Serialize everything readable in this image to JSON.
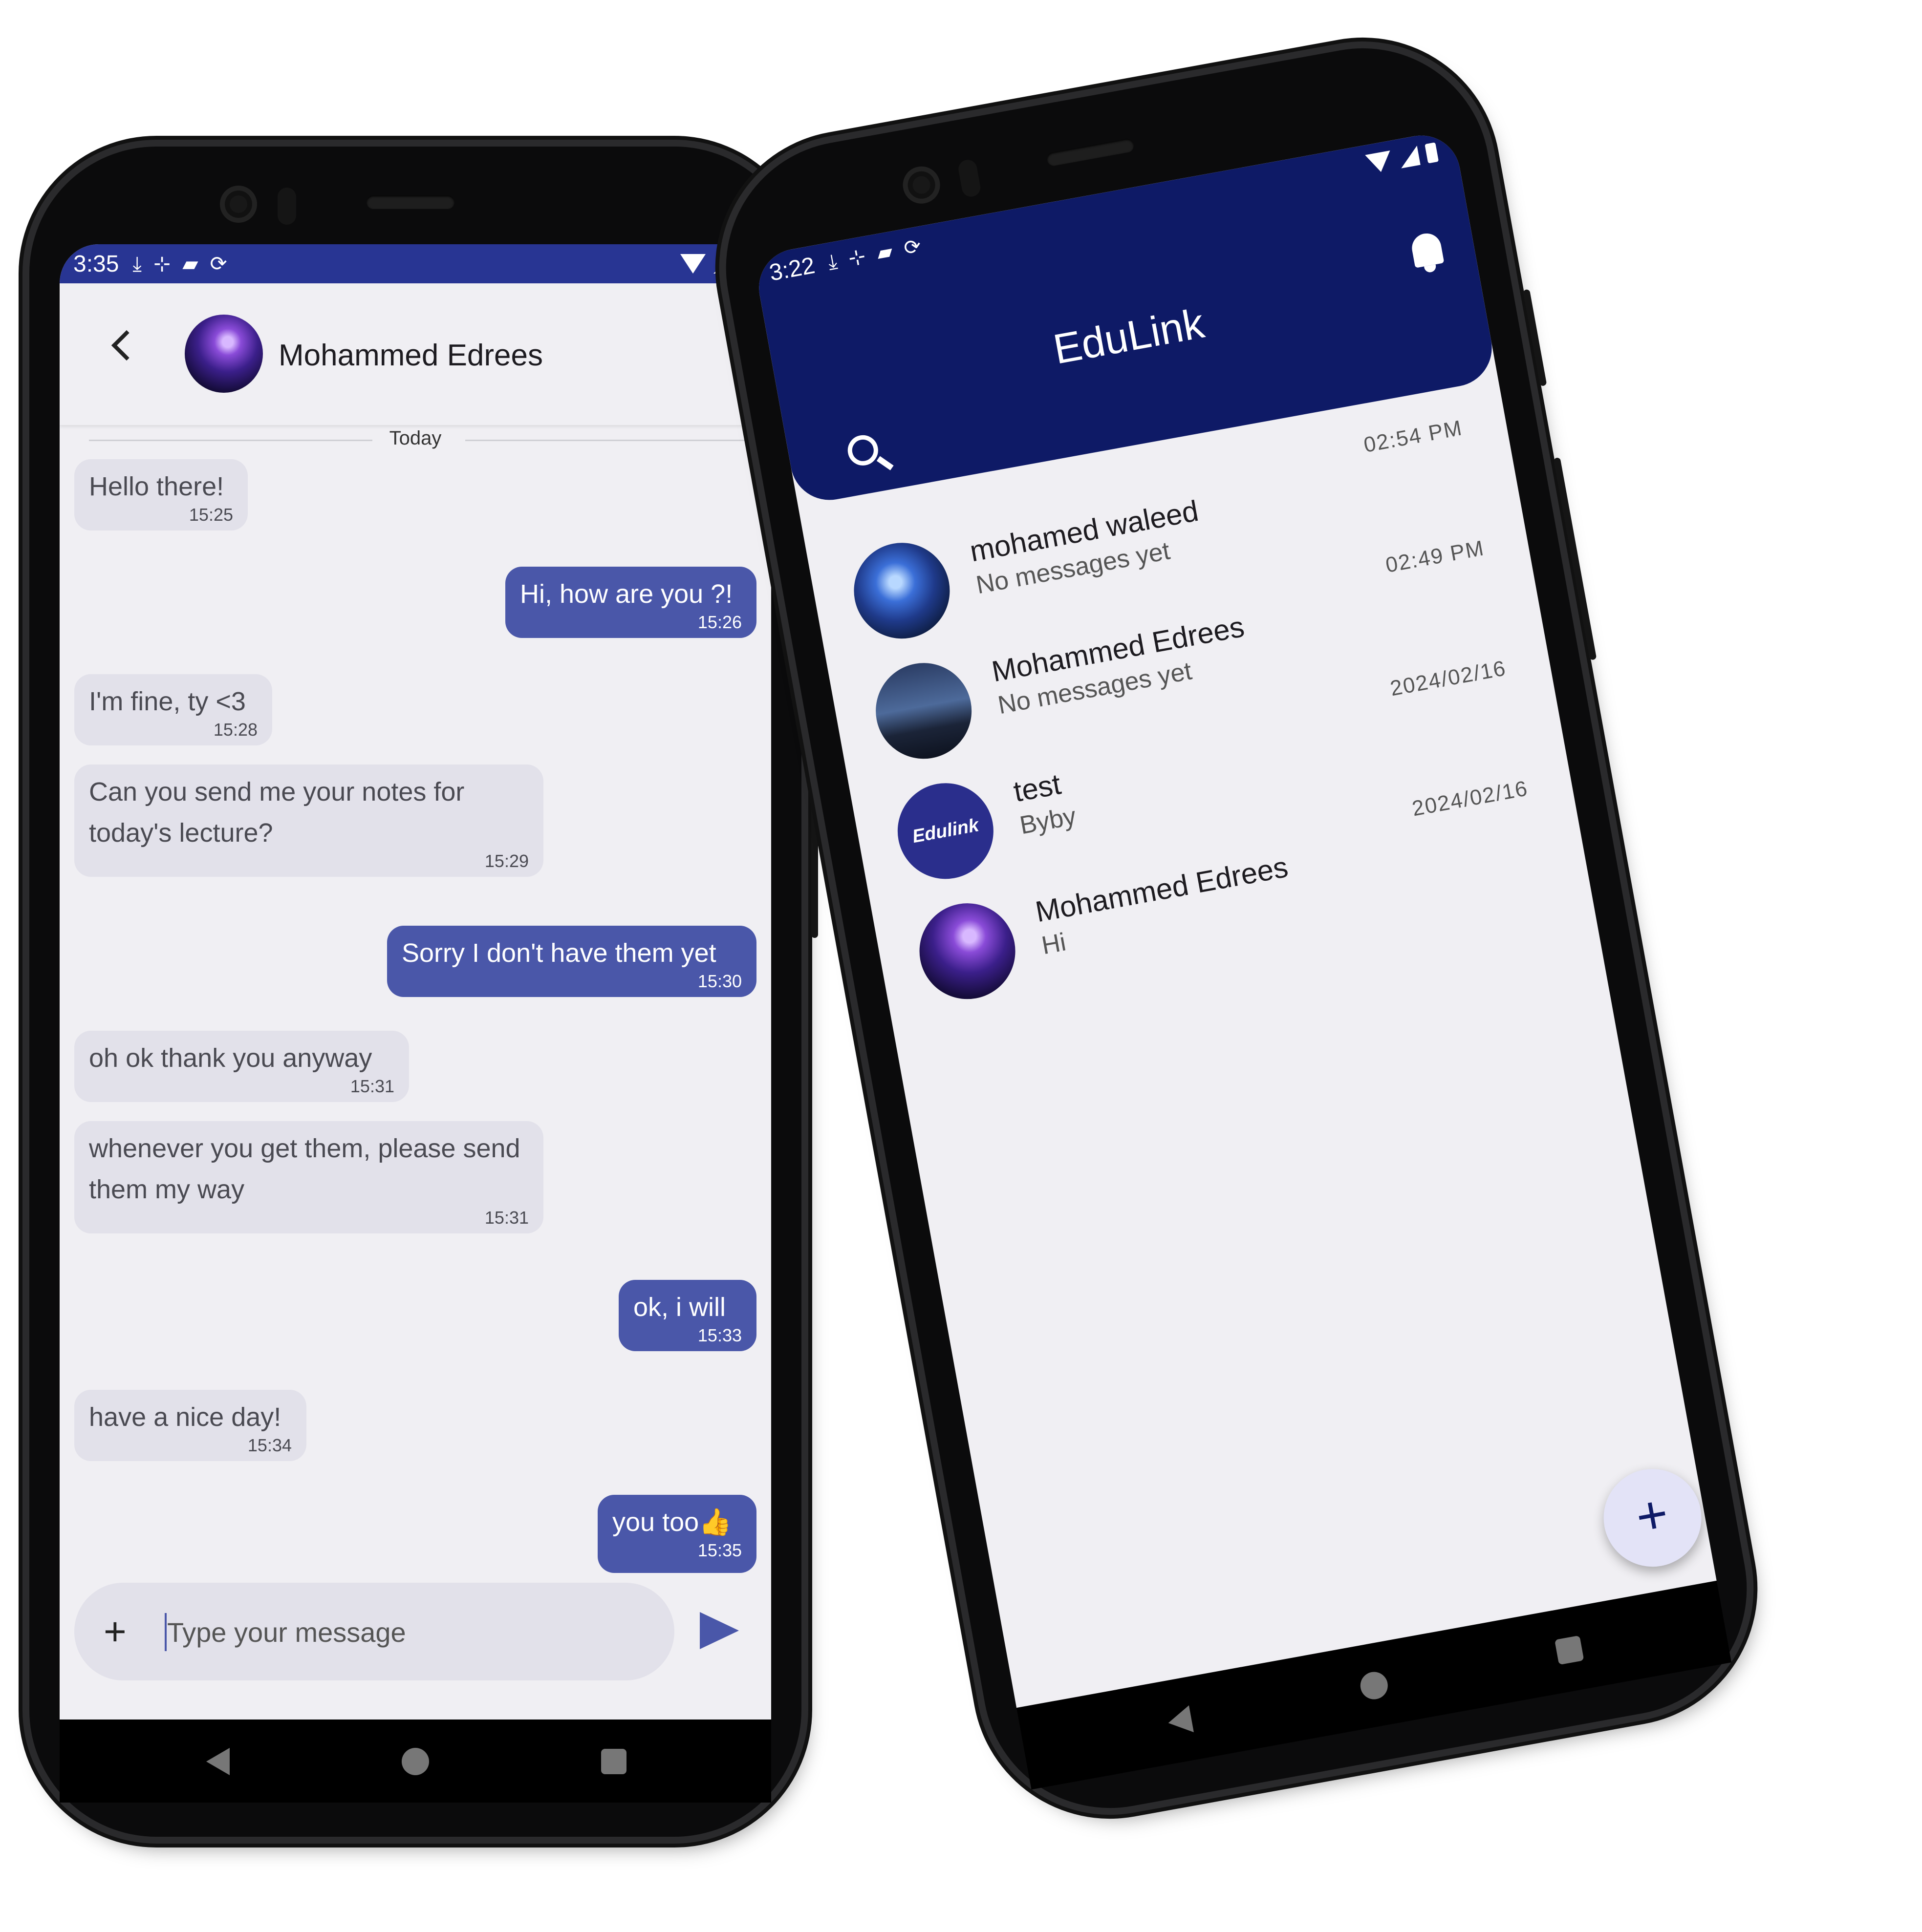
{
  "left_phone": {
    "status": {
      "time": "3:35"
    },
    "chat": {
      "contact_name": "Mohammed Edrees",
      "date_separator": "Today",
      "messages": [
        {
          "dir": "in",
          "text": "Hello there!",
          "time": "15:25"
        },
        {
          "dir": "out",
          "text": "Hi, how are you ?!",
          "time": "15:26"
        },
        {
          "dir": "in",
          "text": "I'm fine, ty <3",
          "time": "15:28"
        },
        {
          "dir": "in",
          "text": "Can you send me your notes for today's lecture?",
          "time": "15:29"
        },
        {
          "dir": "out",
          "text": "Sorry I don't have them yet",
          "time": "15:30"
        },
        {
          "dir": "in",
          "text": "oh ok thank you anyway",
          "time": "15:31"
        },
        {
          "dir": "in",
          "text": "whenever you get them, please send them my way",
          "time": "15:31"
        },
        {
          "dir": "out",
          "text": "ok, i will",
          "time": "15:33"
        },
        {
          "dir": "in",
          "text": "have a nice day!",
          "time": "15:34"
        },
        {
          "dir": "out",
          "text": "you too👍",
          "time": "15:35"
        }
      ],
      "composer_placeholder": "Type your message"
    }
  },
  "right_phone": {
    "status": {
      "time": "3:22"
    },
    "app_title": "EduLink",
    "avatar_text": "Edulink",
    "conversations": [
      {
        "name": "mohamed  waleed",
        "preview": "No messages yet",
        "time": "02:54 PM",
        "avatar": "avatar-blue"
      },
      {
        "name": "Mohammed Edrees",
        "preview": "No messages yet",
        "time": "02:49 PM",
        "avatar": "avatar-city"
      },
      {
        "name": "test",
        "preview": "Byby",
        "time": "2024/02/16",
        "avatar": "avatar-edulink"
      },
      {
        "name": "Mohammed Edrees",
        "preview": "Hi",
        "time": "2024/02/16",
        "avatar": "avatar-purple"
      }
    ],
    "fab_label": "+"
  },
  "colors": {
    "status_bar": "#283593",
    "header": "#0e1a66",
    "outgoing_bubble": "#4a57a9",
    "incoming_bubble": "#e2e1ea",
    "screen_bg": "#f0eff3"
  },
  "icons": [
    "back-arrow-icon",
    "plus-icon",
    "send-icon",
    "search-icon",
    "bell-icon",
    "wifi-icon",
    "signal-icon",
    "battery-icon",
    "download-icon",
    "sd-card-icon"
  ]
}
